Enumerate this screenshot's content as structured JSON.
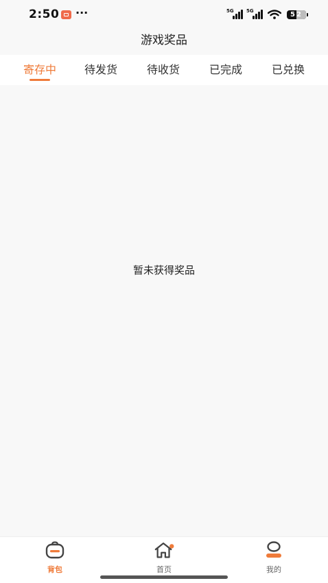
{
  "status": {
    "time": "2:50",
    "more": "···",
    "signal1": "5G",
    "signal2": "5G",
    "battery": "52"
  },
  "header": {
    "title": "游戏奖品"
  },
  "tabs": [
    {
      "label": "寄存中",
      "active": true
    },
    {
      "label": "待发货",
      "active": false
    },
    {
      "label": "待收货",
      "active": false
    },
    {
      "label": "已完成",
      "active": false
    },
    {
      "label": "已兑换",
      "active": false
    }
  ],
  "main": {
    "empty_text": "暂未获得奖品"
  },
  "tabbar": [
    {
      "label": "背包",
      "icon": "backpack-icon",
      "active": true
    },
    {
      "label": "首页",
      "icon": "home-icon",
      "active": false
    },
    {
      "label": "我的",
      "icon": "profile-icon",
      "active": false
    }
  ],
  "colors": {
    "accent": "#ef7b3a",
    "background": "#f8f8f8"
  }
}
